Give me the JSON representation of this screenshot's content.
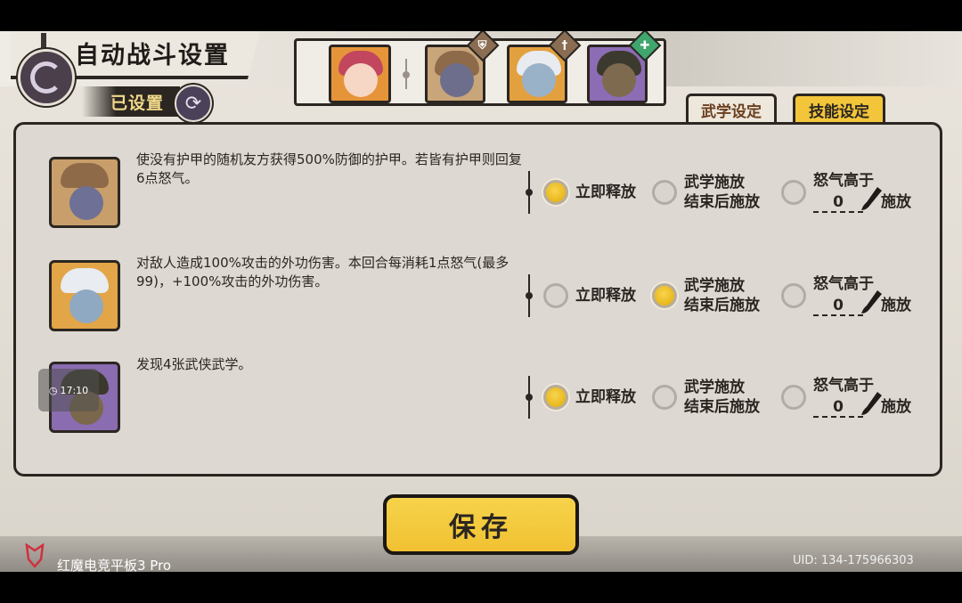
{
  "header": {
    "title": "自动战斗设置",
    "configured_label": "已设置"
  },
  "tabs": [
    {
      "label": "武学设定",
      "active": false
    },
    {
      "label": "技能设定",
      "active": true
    }
  ],
  "skills": [
    {
      "description": "使没有护甲的随机友方获得500%防御的护甲。若皆有护甲则回复6点怒气。",
      "selected_option": "immediate",
      "rage_threshold": "0"
    },
    {
      "description": "对敌人造成100%攻击的外功伤害。本回合每消耗1点怒气(最多99)，+100%攻击的外功伤害。",
      "selected_option": "after_martial",
      "rage_threshold": "0"
    },
    {
      "description": "发现4张武侠武学。",
      "selected_option": "immediate",
      "rage_threshold": "0"
    }
  ],
  "options": {
    "immediate": "立即释放",
    "after_martial_line1": "武学施放",
    "after_martial_line2": "结束后施放",
    "rage_line1": "怒气高于",
    "rage_cast": "施放"
  },
  "toast_time": "17:10",
  "save_label": "保存",
  "footer": {
    "device": "红魔电竞平板3 Pro",
    "uid": "UID:  134-175966303"
  },
  "colors": {
    "accent_yellow": "#f1c132",
    "ink": "#2b2621",
    "panel": "#ddd8d2"
  }
}
